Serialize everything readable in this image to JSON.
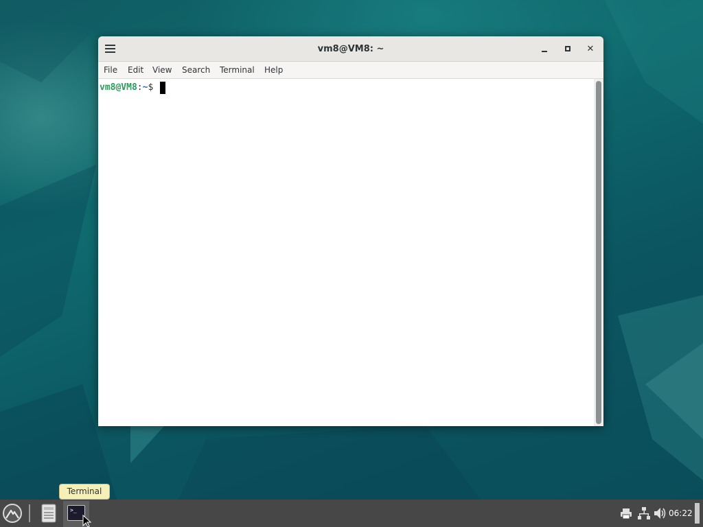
{
  "window": {
    "title": "vm8@VM8: ~",
    "menu": [
      "File",
      "Edit",
      "View",
      "Search",
      "Terminal",
      "Help"
    ]
  },
  "terminal": {
    "prompt_user": "vm8@VM8",
    "prompt_colon": ":",
    "prompt_path": "~",
    "prompt_symbol": "$ "
  },
  "taskbar": {
    "tooltip": "Terminal",
    "clock": "06:22",
    "terminal_icon_text": ">_",
    "tray_icons": [
      "printer-icon",
      "network-icon",
      "volume-icon"
    ]
  },
  "colors": {
    "desktop": "#0e5e66",
    "taskbar": "#474747",
    "prompt_user": "#2a9d5c",
    "prompt_path": "#3465a4",
    "tooltip_bg": "#f5efb8"
  }
}
